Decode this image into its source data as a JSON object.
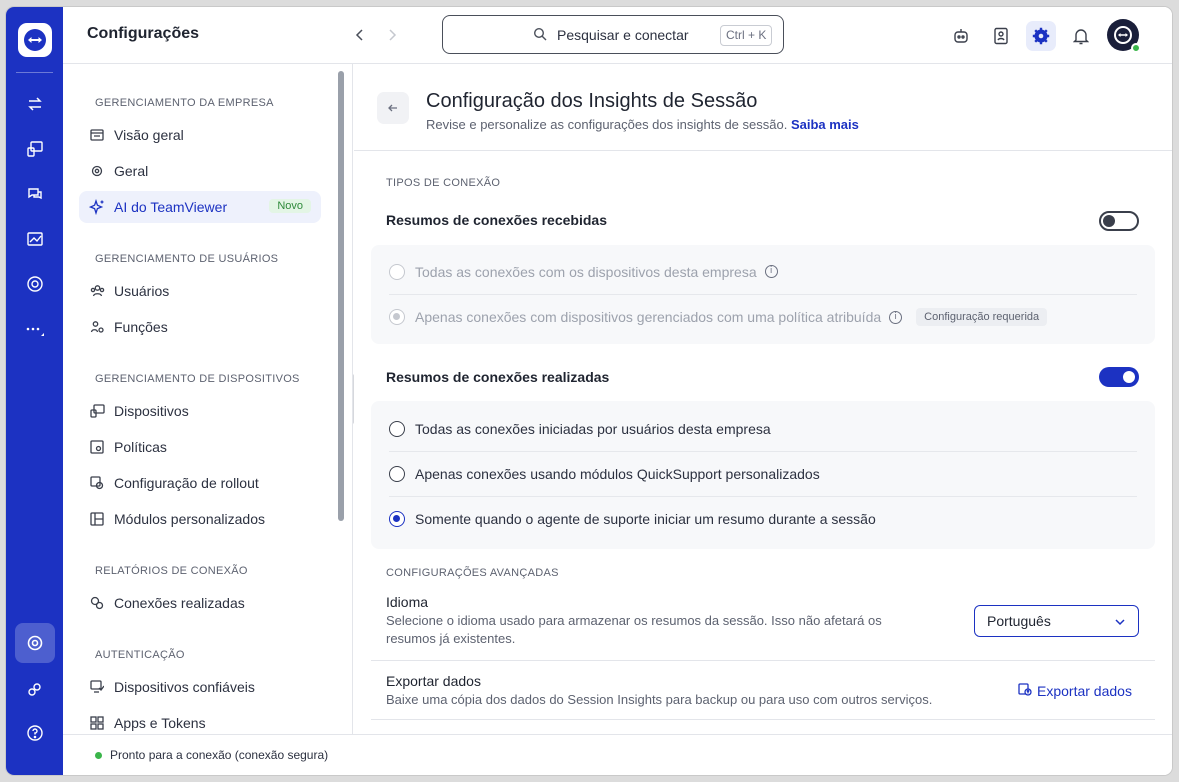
{
  "topbar": {
    "title": "Configurações",
    "search_placeholder": "Pesquisar e conectar",
    "search_shortcut": "Ctrl + K"
  },
  "sidebar": {
    "sections": [
      {
        "title": "GERENCIAMENTO DA EMPRESA",
        "items": [
          {
            "label": "Visão geral",
            "icon": "overview-icon"
          },
          {
            "label": "Geral",
            "icon": "gear-icon"
          },
          {
            "label": "AI do TeamViewer",
            "icon": "sparkle-icon",
            "badge": "Novo",
            "active": true
          }
        ]
      },
      {
        "title": "GERENCIAMENTO DE USUÁRIOS",
        "items": [
          {
            "label": "Usuários",
            "icon": "users-icon"
          },
          {
            "label": "Funções",
            "icon": "roles-icon"
          }
        ]
      },
      {
        "title": "GERENCIAMENTO DE DISPOSITIVOS",
        "items": [
          {
            "label": "Dispositivos",
            "icon": "devices-icon"
          },
          {
            "label": "Políticas",
            "icon": "policies-icon"
          },
          {
            "label": "Configuração de rollout",
            "icon": "rollout-icon"
          },
          {
            "label": "Módulos personalizados",
            "icon": "modules-icon"
          }
        ]
      },
      {
        "title": "RELATÓRIOS DE CONEXÃO",
        "items": [
          {
            "label": "Conexões realizadas",
            "icon": "connections-icon"
          }
        ]
      },
      {
        "title": "AUTENTICAÇÃO",
        "items": [
          {
            "label": "Dispositivos confiáveis",
            "icon": "trusted-devices-icon"
          },
          {
            "label": "Apps e Tokens",
            "icon": "apps-icon"
          }
        ]
      }
    ]
  },
  "main": {
    "title": "Configuração dos Insights de Sessão",
    "subtitle": "Revise e personalize as configurações dos insights de sessão.",
    "learn_more": "Saiba mais",
    "connection_types_header": "TIPOS DE CONEXÃO",
    "incoming": {
      "label": "Resumos de conexões recebidas",
      "enabled": false,
      "option1": "Todas as conexões com os dispositivos desta empresa",
      "option2": "Apenas conexões com dispositivos gerenciados com uma política atribuída",
      "option2_chip": "Configuração requerida"
    },
    "outgoing": {
      "label": "Resumos de conexões realizadas",
      "enabled": true,
      "option1": "Todas as conexões iniciadas por usuários desta empresa",
      "option2": "Apenas conexões usando módulos QuickSupport personalizados",
      "option3": "Somente quando o agente de suporte iniciar um resumo durante a sessão"
    },
    "advanced_header": "CONFIGURAÇÕES AVANÇADAS",
    "language": {
      "label": "Idioma",
      "desc_line1": "Selecione o idioma usado para armazenar os resumos da sessão. Isso não afetará os",
      "desc_line2": "resumos já existentes.",
      "value": "Português"
    },
    "export": {
      "label": "Exportar dados",
      "desc": "Baixe uma cópia dos dados do Session Insights para backup ou para uso com outros serviços.",
      "button": "Exportar dados"
    }
  },
  "status": {
    "text": "Pronto para a conexão (conexão segura)"
  },
  "colors": {
    "brand": "#1c32c2",
    "online": "#3ab54a"
  }
}
